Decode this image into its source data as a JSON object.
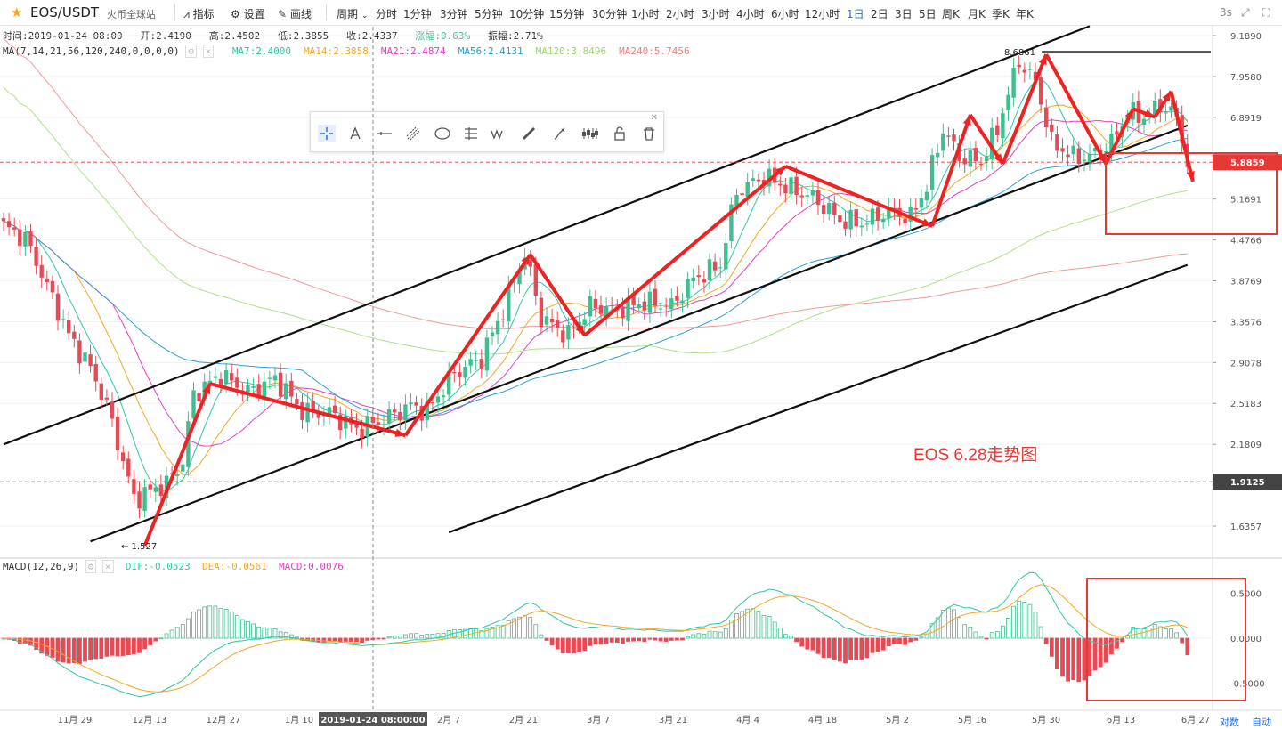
{
  "header": {
    "symbol": "EOS/USDT",
    "exchange": "火币全球站",
    "indicator_label": "指标",
    "settings_label": "设置",
    "draw_label": "画线",
    "period_label": "周期",
    "periods": [
      "分时",
      "1分钟",
      "3分钟",
      "5分钟",
      "10分钟",
      "15分钟",
      "30分钟",
      "1小时",
      "2小时",
      "3小时",
      "4小时",
      "6小时",
      "12小时",
      "1日",
      "2日",
      "3日",
      "5日",
      "周K",
      "月K",
      "季K",
      "年K"
    ],
    "active_period": "1日",
    "refresh_label": "3s"
  },
  "ohlc_info": {
    "time": "时间:2019-01-24 08:00",
    "open": "开:2.4190",
    "high": "高:2.4502",
    "low": "低:2.3855",
    "close": "收:2.4337",
    "change": "涨幅:0.63%",
    "amplitude": "振幅:2.71%"
  },
  "ma_legend": {
    "label": "MA(7,14,21,56,120,240,0,0,0,0)",
    "items": [
      {
        "text": "MA7:2.4000",
        "color": "#2ec7a7"
      },
      {
        "text": "MA14:2.3858",
        "color": "#f5a623"
      },
      {
        "text": "MA21:2.4874",
        "color": "#e040c8"
      },
      {
        "text": "MA56:2.4131",
        "color": "#2a9fd6"
      },
      {
        "text": "MA120:3.8496",
        "color": "#9bd86b"
      },
      {
        "text": "MA240:5.7456",
        "color": "#f08080"
      }
    ]
  },
  "macd_legend": {
    "label": "MACD(12,26,9)",
    "dif": "DIF:-0.0523",
    "dea": "DEA:-0.0561",
    "macd": "MACD:0.0076",
    "dif_color": "#2ec7a7",
    "dea_color": "#f5a623",
    "macd_color": "#e040c8"
  },
  "chart_data": {
    "type": "candlestick",
    "title": "EOS 6.28走势图",
    "title_color": "#e53935",
    "y_ticks": [
      "9.1890",
      "7.9580",
      "6.8919",
      "5.1691",
      "4.4766",
      "3.8769",
      "3.3576",
      "2.9078",
      "2.5183",
      "2.1809",
      "1.6357"
    ],
    "price_tags": [
      {
        "label": "5.8859",
        "color": "#e53935"
      },
      {
        "label": "1.9125",
        "color": "#444444"
      }
    ],
    "x_ticks": [
      "11月 29",
      "12月 13",
      "12月 27",
      "1月 10",
      "2月 7",
      "2月 21",
      "3月 7",
      "3月 21",
      "4月 4",
      "4月 18",
      "5月 2",
      "5月 16",
      "5月 30",
      "6月 13",
      "6月 27"
    ],
    "crosshair_date": "2019-01-24 08:00:00",
    "high_label": "8.6861",
    "low_label": "1.527",
    "macd_ticks": [
      "0.5000",
      "0.0000",
      "-0.5000"
    ],
    "up_color": "#3fbf8f",
    "down_color": "#e84a55",
    "arrow_color": "#ee2222",
    "anchors": [
      {
        "i": 0,
        "p": 4.7
      },
      {
        "i": 4,
        "p": 4.5
      },
      {
        "i": 8,
        "p": 3.8
      },
      {
        "i": 12,
        "p": 3.2
      },
      {
        "i": 16,
        "p": 2.85
      },
      {
        "i": 19,
        "p": 2.5
      },
      {
        "i": 22,
        "p": 2.05
      },
      {
        "i": 24,
        "p": 1.8
      },
      {
        "i": 27,
        "p": 1.85
      },
      {
        "i": 30,
        "p": 1.9
      },
      {
        "i": 33,
        "p": 2.05
      },
      {
        "i": 35,
        "p": 2.6
      },
      {
        "i": 40,
        "p": 2.78
      },
      {
        "i": 45,
        "p": 2.62
      },
      {
        "i": 50,
        "p": 2.75
      },
      {
        "i": 55,
        "p": 2.45
      },
      {
        "i": 60,
        "p": 2.44
      },
      {
        "i": 65,
        "p": 2.3
      },
      {
        "i": 70,
        "p": 2.38
      },
      {
        "i": 75,
        "p": 2.5
      },
      {
        "i": 78,
        "p": 2.45
      },
      {
        "i": 83,
        "p": 2.8
      },
      {
        "i": 88,
        "p": 2.95
      },
      {
        "i": 92,
        "p": 3.5
      },
      {
        "i": 96,
        "p": 4.25
      },
      {
        "i": 99,
        "p": 3.4
      },
      {
        "i": 104,
        "p": 3.2
      },
      {
        "i": 108,
        "p": 3.55
      },
      {
        "i": 113,
        "p": 3.5
      },
      {
        "i": 118,
        "p": 3.6
      },
      {
        "i": 123,
        "p": 3.55
      },
      {
        "i": 127,
        "p": 3.9
      },
      {
        "i": 132,
        "p": 4.1
      },
      {
        "i": 135,
        "p": 5.3
      },
      {
        "i": 140,
        "p": 5.6
      },
      {
        "i": 144,
        "p": 5.4
      },
      {
        "i": 149,
        "p": 5.2
      },
      {
        "i": 154,
        "p": 4.8
      },
      {
        "i": 158,
        "p": 4.75
      },
      {
        "i": 163,
        "p": 4.95
      },
      {
        "i": 167,
        "p": 4.85
      },
      {
        "i": 170,
        "p": 5.4
      },
      {
        "i": 173,
        "p": 6.6
      },
      {
        "i": 176,
        "p": 6.0
      },
      {
        "i": 180,
        "p": 5.9
      },
      {
        "i": 183,
        "p": 6.6
      },
      {
        "i": 187,
        "p": 8.4
      },
      {
        "i": 190,
        "p": 7.8
      },
      {
        "i": 193,
        "p": 6.3
      },
      {
        "i": 197,
        "p": 6.0
      },
      {
        "i": 200,
        "p": 6.0
      },
      {
        "i": 204,
        "p": 6.3
      },
      {
        "i": 207,
        "p": 7.0
      },
      {
        "i": 210,
        "p": 6.9
      },
      {
        "i": 213,
        "p": 7.2
      },
      {
        "i": 216,
        "p": 6.9
      },
      {
        "i": 218,
        "p": 5.88
      }
    ],
    "marked_swings": [
      1.527,
      2.7,
      2.25,
      4.25,
      3.2,
      5.8,
      4.7,
      6.95,
      5.85,
      8.6,
      5.85,
      7.1,
      6.9,
      7.55,
      5.5
    ]
  },
  "footer": {
    "log_label": "对数",
    "auto_label": "自动"
  }
}
